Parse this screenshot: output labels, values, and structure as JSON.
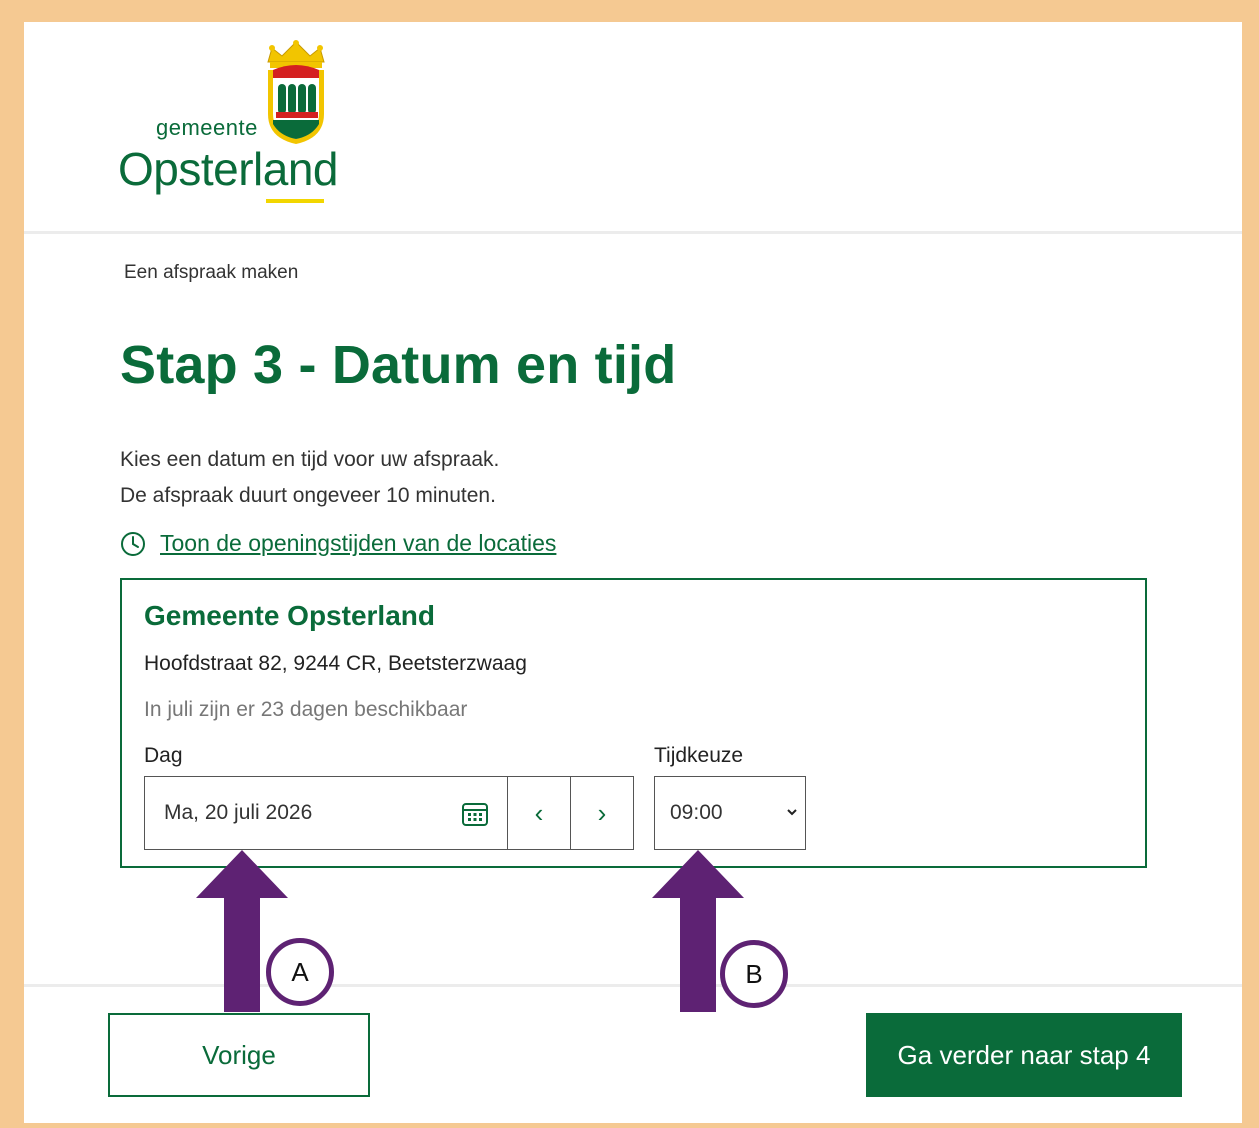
{
  "header": {
    "logo_small": "gemeente",
    "logo_big": "Opsterland"
  },
  "breadcrumb": "Een afspraak maken",
  "page_title": "Stap 3 - Datum en tijd",
  "intro": {
    "line1": "Kies een datum en tijd voor uw afspraak.",
    "line2": "De afspraak duurt ongeveer 10 minuten."
  },
  "hours_link": {
    "label": "Toon de openingstijden van de locaties",
    "icon": "clock-icon"
  },
  "location": {
    "name": "Gemeente Opsterland",
    "address": "Hoofdstraat 82, 9244 CR, Beetsterzwaag",
    "availability": "In juli zijn er 23 dagen beschikbaar",
    "day_label": "Dag",
    "day_value": "Ma, 20 juli 2026",
    "prev_day": "‹",
    "next_day": "›",
    "time_label": "Tijdkeuze",
    "time_value": "09:00"
  },
  "footer": {
    "prev_label": "Vorige",
    "next_label": "Ga verder naar stap 4"
  },
  "annotations": {
    "a": "A",
    "b": "B",
    "arrow_color": "#5e2273"
  },
  "colors": {
    "brand_green": "#0a6b3a",
    "frame_border": "#f5c992",
    "logo_accent": "#f2d600"
  }
}
